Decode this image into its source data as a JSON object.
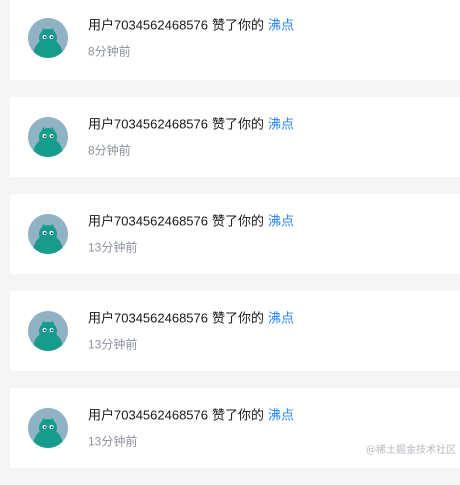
{
  "notifications": [
    {
      "user": "用户7034562468576",
      "action": "赞了你的",
      "target": "沸点",
      "time": "8分钟前"
    },
    {
      "user": "用户7034562468576",
      "action": "赞了你的",
      "target": "沸点",
      "time": "8分钟前"
    },
    {
      "user": "用户7034562468576",
      "action": "赞了你的",
      "target": "沸点",
      "time": "13分钟前"
    },
    {
      "user": "用户7034562468576",
      "action": "赞了你的",
      "target": "沸点",
      "time": "13分钟前"
    },
    {
      "user": "用户7034562468576",
      "action": "赞了你的",
      "target": "沸点",
      "time": "13分钟前"
    }
  ],
  "watermark": "@稀土掘金技术社区",
  "colors": {
    "link": "#1e80ff",
    "avatar_bg": "#8fb3c4",
    "avatar_figure": "#169b8c"
  },
  "icons": {
    "avatar": "default-avatar-icon"
  }
}
